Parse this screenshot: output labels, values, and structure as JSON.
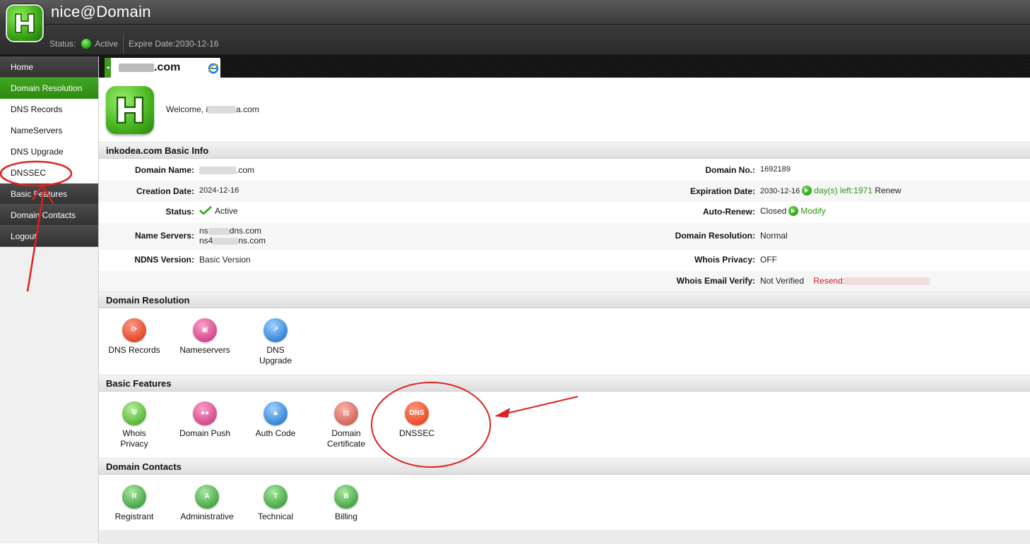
{
  "header": {
    "brand": "nice@Domain",
    "status_label": "Status:",
    "status_value": "Active",
    "expire_label": "Expire Date:",
    "expire_value": "2030-12-16"
  },
  "sidebar": {
    "items": [
      {
        "label": "Home"
      },
      {
        "label": "Domain Resolution"
      },
      {
        "label": "DNS Records"
      },
      {
        "label": "NameServers"
      },
      {
        "label": "DNS Upgrade"
      },
      {
        "label": "DNSSEC"
      },
      {
        "label": "Basic Features"
      },
      {
        "label": "Domain Contacts"
      },
      {
        "label": "Logout"
      }
    ]
  },
  "tab": {
    "label_visible": ".com"
  },
  "welcome": {
    "prefix": "Welcome, i",
    "suffix": "a.com"
  },
  "basic_info": {
    "title": "inkodea.com Basic Info",
    "domain_name_label": "Domain Name:",
    "domain_name_suffix": ".com",
    "creation_label": "Creation Date:",
    "creation_value": "2024-12-16",
    "status_label": "Status:",
    "status_value": "Active",
    "ns_label": "Name Servers:",
    "ns1_prefix": "ns",
    "ns1_suffix": "dns.com",
    "ns2_prefix": "ns4",
    "ns2_suffix": "ns.com",
    "ndns_label": "NDNS Version:",
    "ndns_value": "Basic Version",
    "domain_no_label": "Domain No.:",
    "domain_no_value": "1692189",
    "expiration_label": "Expiration Date:",
    "expiration_value": "2030-12-16",
    "days_left": "day(s) left:1971",
    "renew": "Renew",
    "autorenew_label": "Auto-Renew:",
    "autorenew_value": "Closed",
    "modify": "Modify",
    "resolution_label": "Domain Resolution:",
    "resolution_value": "Normal",
    "whois_privacy_label": "Whois Privacy:",
    "whois_privacy_value": "OFF",
    "whois_email_label": "Whois Email Verify:",
    "whois_email_value": "Not Verified",
    "resend": "Resend:"
  },
  "resolution": {
    "title": "Domain Resolution",
    "items": [
      {
        "label": "DNS Records",
        "icon": "refresh-icon"
      },
      {
        "label": "Nameservers",
        "icon": "monitor-icon"
      },
      {
        "label": "DNS Upgrade",
        "icon": "upgrade-arrow-icon"
      }
    ]
  },
  "features": {
    "title": "Basic Features",
    "items": [
      {
        "label": "Whois Privacy",
        "icon": "shield-icon"
      },
      {
        "label": "Domain Push",
        "icon": "users-icon"
      },
      {
        "label": "Auth Code",
        "icon": "lock-icon"
      },
      {
        "label": "Domain Certificate",
        "icon": "certificate-icon"
      },
      {
        "label": "DNSSEC",
        "icon": "dnssec-icon",
        "icon_text": "DNS"
      }
    ]
  },
  "contacts": {
    "title": "Domain Contacts",
    "items": [
      {
        "label": "Registrant",
        "icon": "person-icon",
        "letter": "R"
      },
      {
        "label": "Administrative",
        "icon": "person-icon",
        "letter": "A"
      },
      {
        "label": "Technical",
        "icon": "person-icon",
        "letter": "T"
      },
      {
        "label": "Billing",
        "icon": "person-icon",
        "letter": "B"
      }
    ]
  },
  "colors": {
    "accent": "#2e8a12",
    "annotation": "#e02020"
  }
}
